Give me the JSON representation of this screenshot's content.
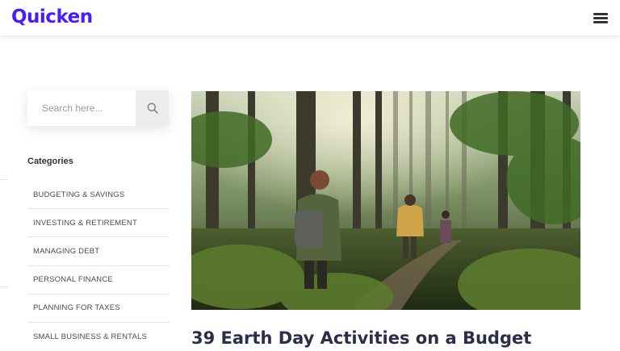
{
  "header": {
    "logo_text": "Quicken",
    "brand_color": "#471cff",
    "menu_icon": "hamburger-icon"
  },
  "sidebar": {
    "search": {
      "placeholder": "Search here...",
      "value": "",
      "button_icon": "search-icon"
    },
    "categories_heading": "Categories",
    "categories": [
      {
        "label": "BUDGETING & SAVINGS"
      },
      {
        "label": "INVESTING & RETIREMENT"
      },
      {
        "label": "MANAGING DEBT"
      },
      {
        "label": "PERSONAL FINANCE"
      },
      {
        "label": "PLANNING FOR TAXES"
      },
      {
        "label": "SMALL BUSINESS & RENTALS"
      }
    ]
  },
  "main": {
    "featured_post": {
      "image": "hikers-in-forest-photo",
      "title": "39 Earth Day Activities on a Budget"
    }
  }
}
